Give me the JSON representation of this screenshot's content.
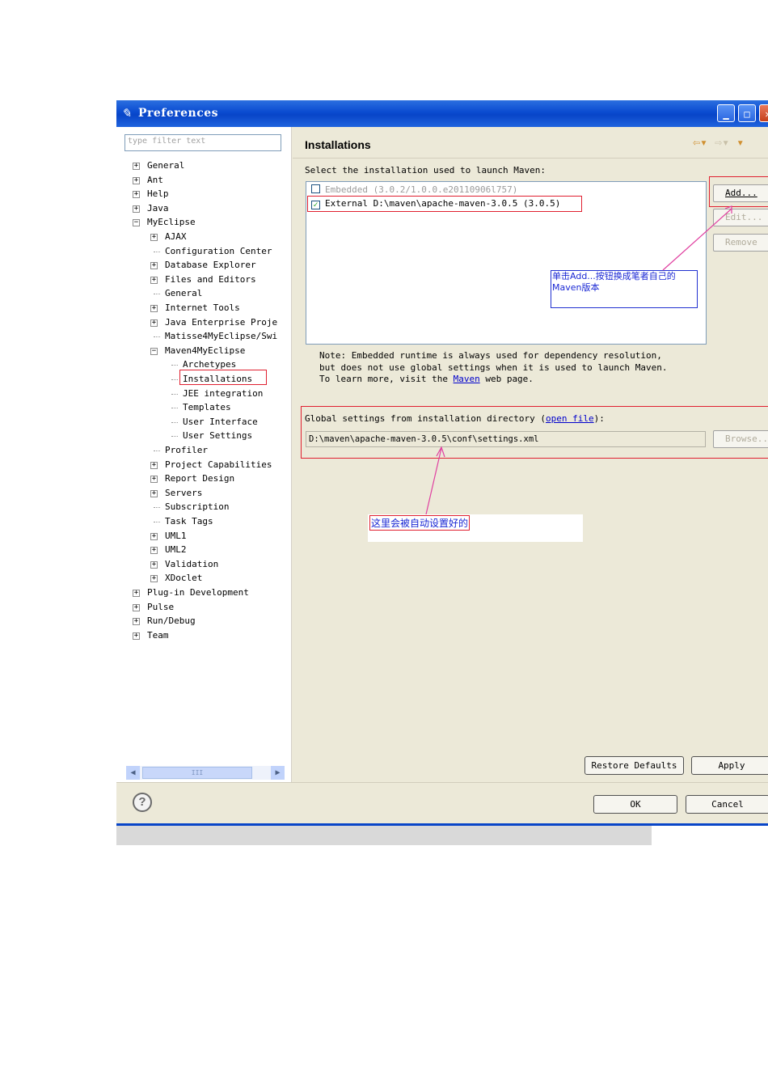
{
  "window": {
    "title": "Preferences"
  },
  "left": {
    "filter_placeholder": "type filter text",
    "tree": [
      {
        "label": "General",
        "expander": "+"
      },
      {
        "label": "Ant",
        "expander": "+"
      },
      {
        "label": "Help",
        "expander": "+"
      },
      {
        "label": "Java",
        "expander": "+"
      },
      {
        "label": "MyEclipse",
        "expander": "-"
      },
      {
        "label": "AJAX",
        "expander": "+"
      },
      {
        "label": "Configuration Center",
        "expander": ""
      },
      {
        "label": "Database Explorer",
        "expander": "+"
      },
      {
        "label": "Files and Editors",
        "expander": "+"
      },
      {
        "label": "General",
        "expander": ""
      },
      {
        "label": "Internet Tools",
        "expander": "+"
      },
      {
        "label": "Java Enterprise Projе",
        "expander": "+"
      },
      {
        "label": "Matisse4MyEclipse/Swi",
        "expander": ""
      },
      {
        "label": "Maven4MyEclipse",
        "expander": "-"
      },
      {
        "label": "Archetypes",
        "expander": ""
      },
      {
        "label": "Installations",
        "expander": ""
      },
      {
        "label": "JEE integration",
        "expander": ""
      },
      {
        "label": "Templates",
        "expander": ""
      },
      {
        "label": "User Interface",
        "expander": ""
      },
      {
        "label": "User Settings",
        "expander": ""
      },
      {
        "label": "Profiler",
        "expander": ""
      },
      {
        "label": "Project Capabilities",
        "expander": "+"
      },
      {
        "label": "Report Design",
        "expander": "+"
      },
      {
        "label": "Servers",
        "expander": "+"
      },
      {
        "label": "Subscription",
        "expander": ""
      },
      {
        "label": "Task Tags",
        "expander": ""
      },
      {
        "label": "UML1",
        "expander": "+"
      },
      {
        "label": "UML2",
        "expander": "+"
      },
      {
        "label": "Validation",
        "expander": "+"
      },
      {
        "label": "XDoclet",
        "expander": "+"
      },
      {
        "label": "Plug-in Development",
        "expander": "+"
      },
      {
        "label": "Pulse",
        "expander": "+"
      },
      {
        "label": "Run/Debug",
        "expander": "+"
      },
      {
        "label": "Team",
        "expander": "+"
      }
    ],
    "scroll_thumb_grip": "III"
  },
  "main": {
    "heading": "Installations",
    "select_label": "Select the installation used to launch Maven:",
    "installations": [
      {
        "label": "Embedded (3.0.2/1.0.0.e20110906l757)",
        "checked": false
      },
      {
        "label": "External D:\\maven\\apache-maven-3.0.5 (3.0.5)",
        "checked": true
      }
    ],
    "buttons": {
      "add": "Add...",
      "edit": "Edit...",
      "remove": "Remove",
      "browse": "Browse...",
      "restore": "Restore Defaults",
      "apply": "Apply",
      "ok": "OK",
      "cancel": "Cancel"
    },
    "note_line1": "Note: Embedded runtime is always used for dependency resolution,",
    "note_line2": "but does not use global settings when it is used to launch Maven.",
    "note_line3_pre": "To learn more, visit the ",
    "note_link": "Maven",
    "note_line3_post": " web page.",
    "global_label_pre": "Global settings from installation directory (",
    "global_link": "open file",
    "global_label_post": "):",
    "settings_path": "D:\\maven\\apache-maven-3.0.5\\conf\\settings.xml"
  },
  "annotations": {
    "add_note": "单击Add...按钮换成笔者自己的Maven版本",
    "auto_note": "这里会被自动设置好的"
  },
  "colors": {
    "titlebar": "#0a4bd0",
    "annotation_red": "#e02030",
    "annotation_blue": "#2030d0",
    "link": "#0000cc"
  },
  "icons": [
    "app-icon",
    "minimize-icon",
    "maximize-icon",
    "close-icon",
    "back-arrow-icon",
    "forward-arrow-icon",
    "help-icon",
    "scroll-left-icon",
    "scroll-right-icon"
  ]
}
